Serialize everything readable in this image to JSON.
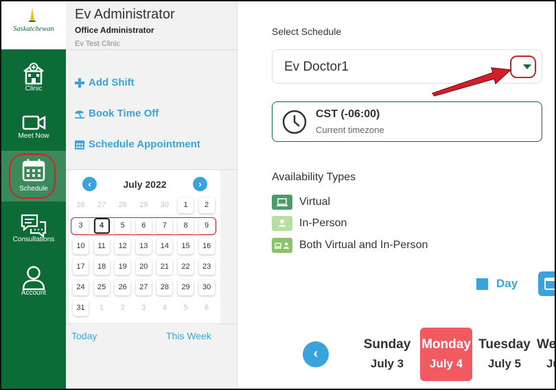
{
  "brand": {
    "name": "Saskatchewan"
  },
  "nav": [
    {
      "label": "Clinic",
      "icon": "hospital-icon"
    },
    {
      "label": "Meet Now",
      "icon": "video-camera-icon"
    },
    {
      "label": "Schedule",
      "icon": "calendar-icon",
      "active": true
    },
    {
      "label": "Consultations",
      "icon": "chat-bubbles-icon"
    },
    {
      "label": "Account",
      "icon": "user-icon"
    }
  ],
  "user": {
    "name": "Ev Administrator",
    "role": "Office Administrator",
    "clinic": "Ev Test Clinic"
  },
  "actions": {
    "add_shift": "Add Shift",
    "book_time_off": "Book Time Off",
    "schedule_appointment": "Schedule Appointment"
  },
  "calendar": {
    "month": "July 2022",
    "prev": "‹",
    "next": "›",
    "weeks": [
      [
        "26",
        "27",
        "28",
        "29",
        "30",
        "1",
        "2"
      ],
      [
        "3",
        "4",
        "5",
        "6",
        "7",
        "8",
        "9"
      ],
      [
        "10",
        "11",
        "12",
        "13",
        "14",
        "15",
        "16"
      ],
      [
        "17",
        "18",
        "19",
        "20",
        "21",
        "22",
        "23"
      ],
      [
        "24",
        "25",
        "26",
        "27",
        "28",
        "29",
        "30"
      ],
      [
        "31",
        "1",
        "2",
        "3",
        "4",
        "5",
        "6"
      ]
    ],
    "today": "4",
    "today_link": "Today",
    "this_week_link": "This Week"
  },
  "schedule": {
    "label": "Select Schedule",
    "selected": "Ev Doctor1"
  },
  "timezone": {
    "name": "CST (-06:00)",
    "caption": "Current timezone"
  },
  "availability": {
    "title": "Availability Types",
    "types": [
      {
        "label": "Virtual",
        "color": "#4e9a6a"
      },
      {
        "label": "In-Person",
        "color": "#b9dfa0"
      },
      {
        "label": "Both Virtual and In-Person",
        "color": "#8cc36a"
      }
    ]
  },
  "view": {
    "day_label": "Day",
    "accent": "#3aa3dc"
  },
  "week": {
    "prev": "‹",
    "days": [
      {
        "name": "Sunday",
        "date": "July 3"
      },
      {
        "name": "Monday",
        "date": "July 4",
        "selected": true
      },
      {
        "name": "Tuesday",
        "date": "July 5"
      },
      {
        "name": "We",
        "date": "Ju"
      }
    ]
  },
  "colors": {
    "brand_green": "#0d6b38",
    "highlight": "#f25a62",
    "annotation_red": "#d31f2a"
  }
}
